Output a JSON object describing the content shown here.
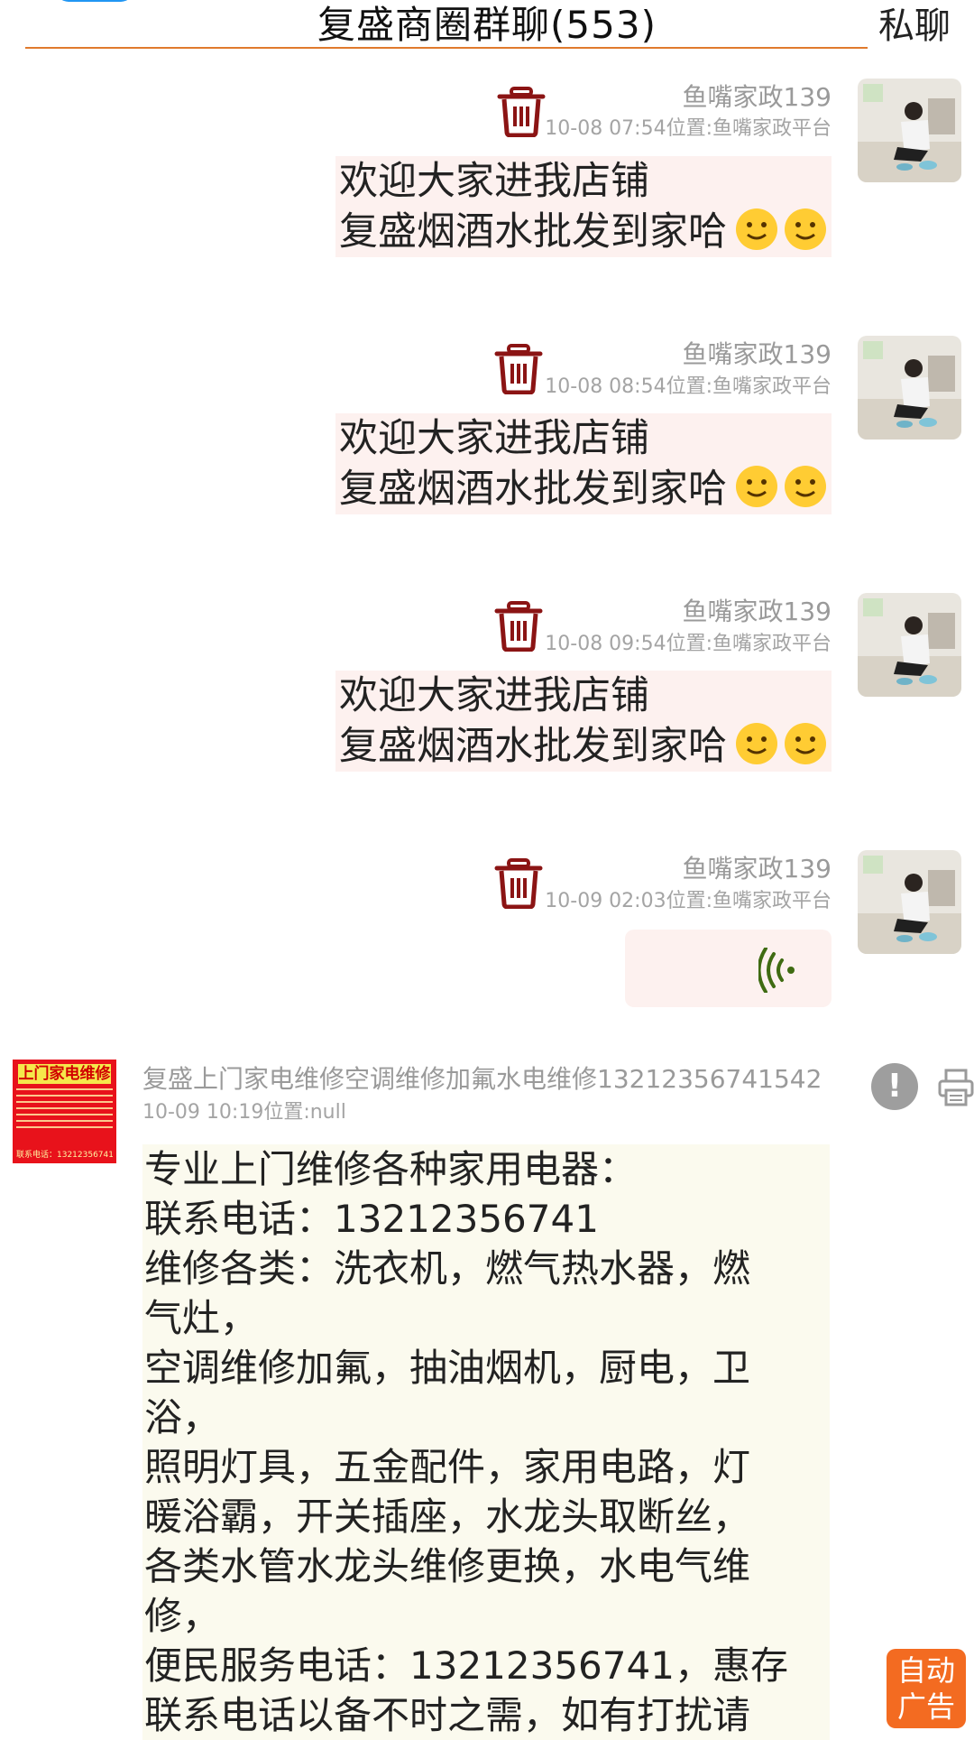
{
  "header": {
    "title": "复盛商圈群聊(553)",
    "private_chat": "私聊"
  },
  "messages": [
    {
      "sender": "鱼嘴家政139",
      "meta": "10-08 07:54位置:鱼嘴家政平台",
      "lines": [
        "欢迎大家进我店铺",
        "复盛烟酒水批发到家哈"
      ],
      "emoji": [
        "slightly-smiling-face",
        "slightly-smiling-face"
      ]
    },
    {
      "sender": "鱼嘴家政139",
      "meta": "10-08 08:54位置:鱼嘴家政平台",
      "lines": [
        "欢迎大家进我店铺",
        "复盛烟酒水批发到家哈"
      ],
      "emoji": [
        "slightly-smiling-face",
        "slightly-smiling-face"
      ]
    },
    {
      "sender": "鱼嘴家政139",
      "meta": "10-08 09:54位置:鱼嘴家政平台",
      "lines": [
        "欢迎大家进我店铺",
        "复盛烟酒水批发到家哈"
      ],
      "emoji": [
        "slightly-smiling-face",
        "slightly-smiling-face"
      ]
    },
    {
      "sender": "鱼嘴家政139",
      "meta": "10-09 02:03位置:鱼嘴家政平台",
      "type": "voice"
    },
    {
      "sender": "复盛上门家电维修空调维修加氟水电维修13212356741542",
      "meta": "10-09 10:19位置:null",
      "avatar_text": "上门家电维修",
      "avatar_footer": "联系电话：13212356741",
      "lines": [
        "专业上门维修各种家用电器：",
        "联系电话：13212356741",
        "维修各类：洗衣机，燃气热水器，燃",
        "气灶，",
        "空调维修加氟，抽油烟机，厨电，卫",
        "浴，",
        "照明灯具，五金配件，家用电路，灯",
        "暖浴霸，开关插座，水龙头取断丝，",
        "各类水管水龙头维修更换，水电气维",
        "修，",
        "便民服务电话：13212356741，惠存",
        "联系电话以备不时之需，如有打扰请"
      ]
    }
  ],
  "auto_ad": [
    "自动",
    "广告"
  ],
  "colors": {
    "accent_rule": "#e07a2d",
    "trash": "#8b1414",
    "bubble_right": "#fdf1ef",
    "bubble_left": "#fbfaee",
    "voice_icon": "#3f6b12",
    "auto_ad_bg": "#f36b21"
  }
}
